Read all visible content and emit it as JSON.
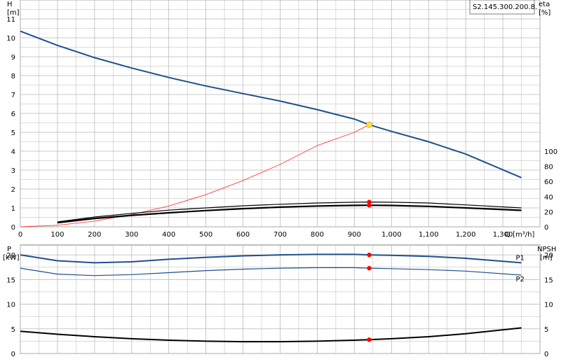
{
  "model_label": "S2.145.300.200.8.",
  "colors": {
    "grid": "#b9b9b9",
    "head_curve": "#1f4f8f",
    "system_curve": "#ff3b3b",
    "efficiency": "#000000",
    "power": "#1f4f8f",
    "npsh": "#000000",
    "duty_point": "#ff0000",
    "duty_point_head": "#ffe23f"
  },
  "chart_data": [
    {
      "type": "line",
      "title": "",
      "x_axis": {
        "label": "Q [m³/h]",
        "range": [
          0,
          1400
        ],
        "ticks": [
          "0",
          "100",
          "200",
          "300",
          "400",
          "500",
          "600",
          "700",
          "800",
          "900",
          "1,000",
          "1,100",
          "1,200",
          "1,300"
        ]
      },
      "y_left": {
        "label_line1": "H",
        "label_line2": "[m]",
        "range": [
          0,
          12
        ],
        "ticks": [
          "0",
          "1",
          "2",
          "3",
          "4",
          "5",
          "6",
          "7",
          "8",
          "9",
          "10",
          "11"
        ]
      },
      "y_right": {
        "label_line1": "eta",
        "label_line2": "[%]",
        "range": [
          0,
          100
        ],
        "ticks": [
          "0",
          "20",
          "40",
          "60",
          "80",
          "100"
        ],
        "tick_values": [
          0,
          20,
          40,
          60,
          80,
          100
        ]
      },
      "grid": true,
      "series": [
        {
          "key": "H",
          "axis": "left",
          "x": [
            0,
            100,
            200,
            300,
            400,
            500,
            600,
            700,
            800,
            900,
            940,
            1000,
            1100,
            1200,
            1350
          ],
          "y": [
            10.35,
            9.6,
            8.95,
            8.4,
            7.9,
            7.45,
            7.05,
            6.65,
            6.2,
            5.7,
            5.4,
            5.05,
            4.5,
            3.85,
            2.6
          ]
        },
        {
          "key": "system",
          "axis": "left",
          "x": [
            0,
            100,
            200,
            300,
            400,
            500,
            600,
            700,
            800,
            900,
            940
          ],
          "y": [
            0,
            0.08,
            0.3,
            0.65,
            1.1,
            1.7,
            2.45,
            3.3,
            4.3,
            5.0,
            5.4
          ]
        },
        {
          "key": "eta_upper",
          "axis": "right",
          "x": [
            100,
            200,
            300,
            400,
            500,
            600,
            700,
            800,
            900,
            940,
            1000,
            1100,
            1200,
            1350
          ],
          "y": [
            6.5,
            13.0,
            17.8,
            22.0,
            25.0,
            27.8,
            29.8,
            31.5,
            32.5,
            32.8,
            32.5,
            31.5,
            29.0,
            25.0
          ]
        },
        {
          "key": "eta_lower",
          "axis": "right",
          "x": [
            100,
            200,
            300,
            400,
            500,
            600,
            700,
            800,
            900,
            940,
            1000,
            1100,
            1200,
            1350
          ],
          "y": [
            5.5,
            11.0,
            15.2,
            18.5,
            21.5,
            24.0,
            26.0,
            27.5,
            28.3,
            28.5,
            28.2,
            27.0,
            25.0,
            21.8
          ]
        }
      ],
      "duty_point": {
        "x": 940,
        "H": 5.4,
        "eta_upper": 32.8,
        "eta_lower": 28.5
      }
    },
    {
      "type": "line",
      "title": "",
      "x_axis": {
        "range": [
          0,
          1400
        ]
      },
      "y_left": {
        "label_line1": "P",
        "label_line2": "[kW]",
        "range": [
          0,
          22
        ],
        "ticks": [
          "0",
          "5",
          "10",
          "15",
          "20"
        ],
        "tick_values": [
          0,
          5,
          10,
          15,
          20
        ]
      },
      "y_right": {
        "label_line1": "NPSH",
        "label_line2": "[m]",
        "range": [
          0,
          22
        ],
        "ticks": [
          "0",
          "5",
          "10",
          "15",
          "20"
        ],
        "tick_values": [
          0,
          5,
          10,
          15,
          20
        ]
      },
      "grid": true,
      "series": [
        {
          "name": "P1",
          "axis": "left",
          "x": [
            0,
            100,
            200,
            300,
            400,
            500,
            600,
            700,
            800,
            900,
            940,
            1000,
            1100,
            1200,
            1350
          ],
          "y": [
            20.0,
            18.8,
            18.4,
            18.6,
            19.1,
            19.5,
            19.8,
            20.0,
            20.1,
            20.1,
            20.0,
            19.9,
            19.7,
            19.3,
            18.4
          ]
        },
        {
          "name": "P2",
          "axis": "left",
          "x": [
            0,
            100,
            200,
            300,
            400,
            500,
            600,
            700,
            800,
            900,
            940,
            1000,
            1100,
            1200,
            1350
          ],
          "y": [
            17.3,
            16.1,
            15.8,
            16.0,
            16.4,
            16.8,
            17.1,
            17.3,
            17.4,
            17.4,
            17.3,
            17.2,
            17.0,
            16.7,
            15.9
          ]
        },
        {
          "key": "NPSH",
          "axis": "right",
          "x": [
            0,
            100,
            200,
            300,
            400,
            500,
            600,
            700,
            800,
            900,
            940,
            1000,
            1100,
            1200,
            1350
          ],
          "y": [
            4.5,
            3.9,
            3.4,
            3.0,
            2.7,
            2.5,
            2.4,
            2.4,
            2.5,
            2.7,
            2.8,
            3.0,
            3.4,
            4.0,
            5.2
          ]
        }
      ],
      "duty_point": {
        "x": 940,
        "P1": 20.0,
        "P2": 17.3,
        "NPSH": 2.8
      }
    }
  ]
}
